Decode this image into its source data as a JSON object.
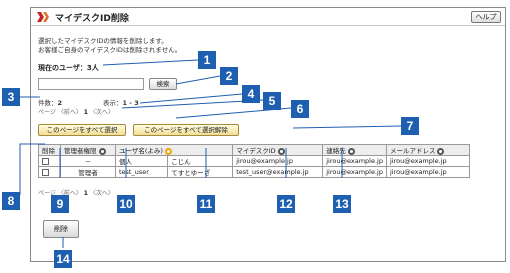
{
  "window": {
    "title": "マイデスクID削除",
    "help_label": "ヘルプ"
  },
  "description": [
    "選択したマイデスクIDの情報を削除します。",
    "お客様ご自身のマイデスクIDは削除されません。"
  ],
  "current_users": "現在のユーザ：3人",
  "search": {
    "value": "",
    "button_label": "検索"
  },
  "summary": {
    "count_label": "件数：",
    "count_value": "2",
    "display_label": "表示：",
    "display_value": "1 - 3"
  },
  "pager": {
    "label": "ページ",
    "prev": "〈前へ〉",
    "current": "1",
    "next": "〈次へ〉"
  },
  "selection": {
    "select_all": "このページをすべて選択",
    "deselect_all": "このページをすべて選択解除"
  },
  "table": {
    "headers": [
      "削除",
      "管理者権限",
      "ユーザ名(よみ)",
      "マイデスクID",
      "連絡先",
      "メールアドレス"
    ],
    "rows": [
      [
        "",
        "－",
        "個人",
        "こじん",
        "jirou@example.jp",
        "jirou@example.jp",
        "jirou@example.jp"
      ],
      [
        "",
        "管理者",
        "test_user",
        "てすとゆーざ",
        "test_user@example.jp",
        "jirou@example.jp",
        "jirou@example.jp"
      ]
    ]
  },
  "delete_label": "削除",
  "callouts": [
    "1",
    "2",
    "3",
    "4",
    "5",
    "6",
    "7",
    "8",
    "9",
    "10",
    "11",
    "12",
    "13",
    "14"
  ],
  "colors": {
    "callout": "#1f5fb0",
    "title_mark": "#c0282a",
    "sort_active": "#f0a500"
  }
}
